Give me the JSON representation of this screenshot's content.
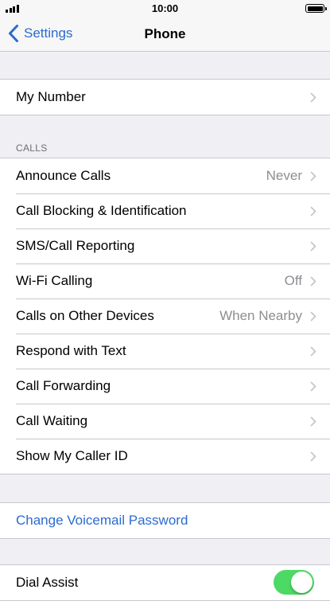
{
  "status_bar": {
    "time": "10:00"
  },
  "nav": {
    "back_label": "Settings",
    "title": "Phone"
  },
  "group1": {
    "items": [
      {
        "label": "My Number",
        "value": ""
      }
    ]
  },
  "calls_section": {
    "header": "CALLS",
    "items": [
      {
        "label": "Announce Calls",
        "value": "Never"
      },
      {
        "label": "Call Blocking & Identification",
        "value": ""
      },
      {
        "label": "SMS/Call Reporting",
        "value": ""
      },
      {
        "label": "Wi-Fi Calling",
        "value": "Off"
      },
      {
        "label": "Calls on Other Devices",
        "value": "When Nearby"
      },
      {
        "label": "Respond with Text",
        "value": ""
      },
      {
        "label": "Call Forwarding",
        "value": ""
      },
      {
        "label": "Call Waiting",
        "value": ""
      },
      {
        "label": "Show My Caller ID",
        "value": ""
      }
    ]
  },
  "voicemail": {
    "change_password_label": "Change Voicemail Password"
  },
  "dial_assist": {
    "label": "Dial Assist",
    "enabled": true
  },
  "colors": {
    "link": "#2b6bd1",
    "toggle_on": "#4cd964",
    "background": "#efeff4"
  },
  "icons": {
    "back": "chevron-left-icon",
    "disclosure": "chevron-right-icon"
  }
}
